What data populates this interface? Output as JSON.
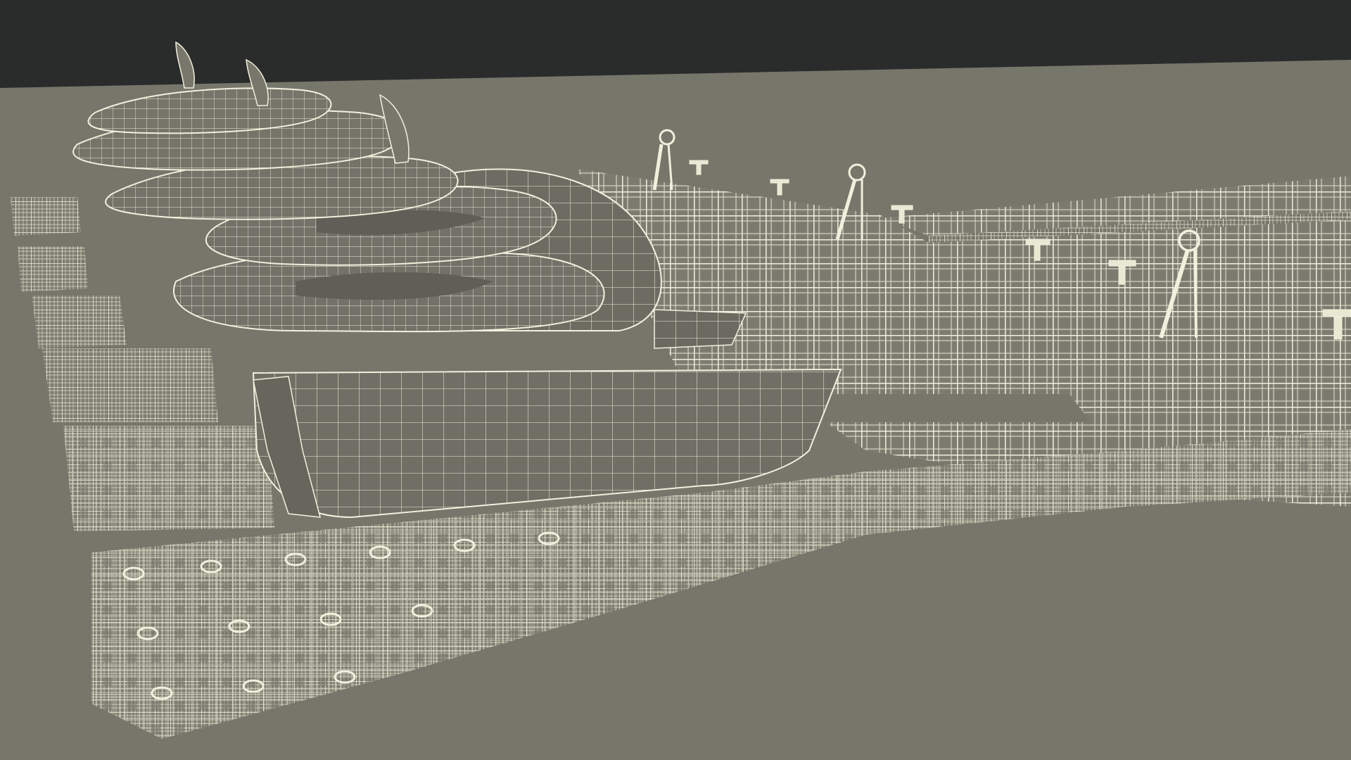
{
  "scene": {
    "subject": "wireframe-render",
    "colors": {
      "backdrop": "#2a2b2b",
      "ground": "#75756a",
      "ground_far": "#7a7a6f",
      "wire": "#f1f0dd",
      "wire_dim": "#d8d7c2",
      "hull_fill": "#6f6f66",
      "hull_shadow": "#5d5d55",
      "dock_fill": "#7d7c70"
    }
  }
}
